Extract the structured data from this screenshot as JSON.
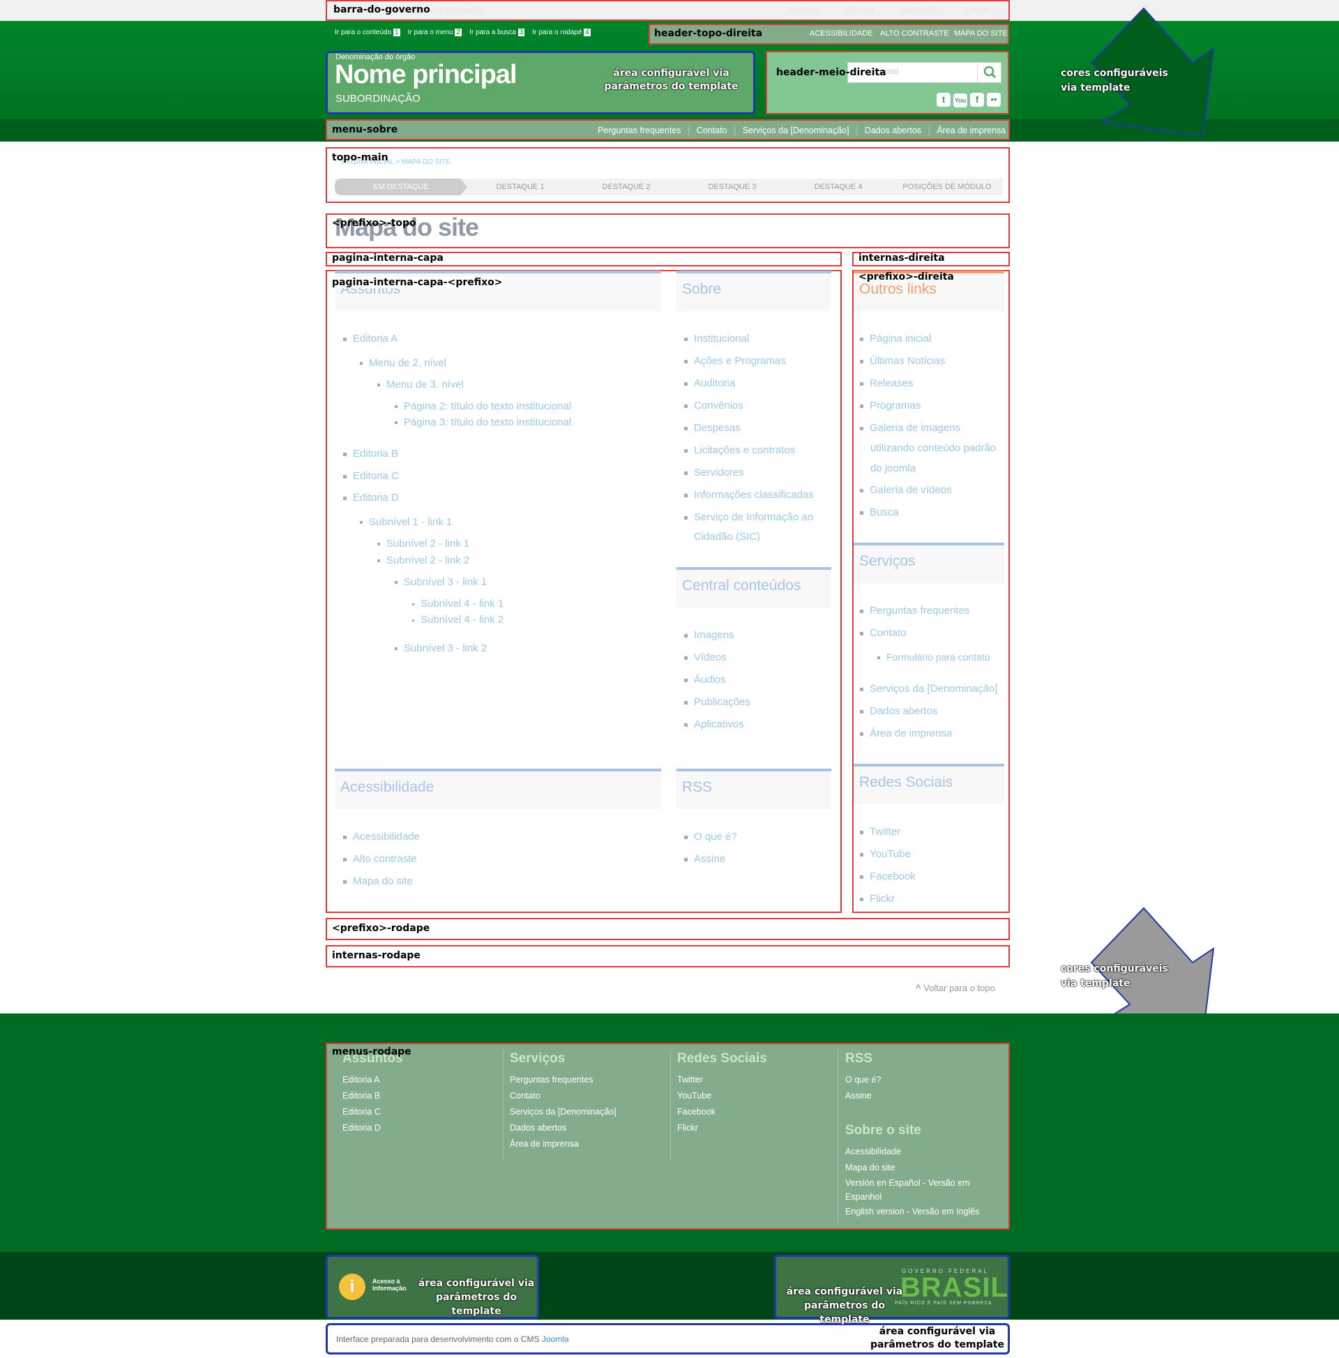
{
  "gov_bar": {
    "label": "barra-do-governo",
    "links": [
      "Acesso à informação",
      "Participe",
      "Serviços",
      "Legislação",
      "Canais"
    ]
  },
  "header": {
    "skip_links": [
      "Ir para o conteúdo",
      "Ir para o menu",
      "Ir para a busca",
      "Ir para o rodapé"
    ],
    "skip_keys": [
      "1",
      "2",
      "3",
      "4"
    ],
    "top_right_label": "header-topo-direita",
    "top_right_links": [
      "ACESSIBILIDADE",
      "ALTO CONTRASTE",
      "MAPA DO SITE"
    ],
    "org_denomination": "Denominação do órgão",
    "main_name": "Nome principal",
    "subordination": "SUBORDINAÇÃO",
    "config_note": "área configurável via parâmetros do template",
    "mid_right_label": "header-meio-direita",
    "search_placeholder": "o portal",
    "social_icons": [
      "twitter-icon",
      "youtube-icon",
      "facebook-icon",
      "flickr-icon"
    ],
    "colors_note": "cores configuráveis via template"
  },
  "menu_sobre": {
    "label": "menu-sobre",
    "links": [
      "Perguntas frequentes",
      "Contato",
      "Serviços da [Denominação]",
      "Dados abertos",
      "Área de imprensa"
    ]
  },
  "topo_main": {
    "label": "topo-main",
    "breadcrumb": "PÁGINA INICIAL > MAPA DO SITE",
    "tabs": [
      "EM DESTAQUE",
      "DESTAQUE 1",
      "DESTAQUE 2",
      "DESTAQUE 3",
      "DESTAQUE 4",
      "POSIÇÕES DE MÓDULO"
    ]
  },
  "prefixo_topo": {
    "label": "<prefixo>-topo",
    "page_title": "Mapa do site"
  },
  "pagina_interna_capa": {
    "label": "pagina-interna-capa",
    "inner_label": "pagina-interna-capa-<prefixo>"
  },
  "internas_direita": {
    "label": "internas-direita",
    "inner_label": "<prefixo>-direita"
  },
  "assuntos": {
    "title": "Assuntos",
    "items": [
      "Editoria A",
      "Menu de 2. nível",
      "Menu de 3. nível",
      "Página 2: título do texto institucional",
      "Página 3: título do texto institucional",
      "Editoria B",
      "Editoria C",
      "Editoria D",
      "Subnível 1 - link 1",
      "Subnível 2 - link 1",
      "Subnível 2 - link 2",
      "Subnível 3 - link 1",
      "Subnível 4 - link 1",
      "Subnível 4 - link 2",
      "Subnível 3 - link 2"
    ]
  },
  "sobre": {
    "title": "Sobre",
    "items": [
      "Institucional",
      "Ações e Programas",
      "Auditoria",
      "Convênios",
      "Despesas",
      "Licitações e contratos",
      "Servidores",
      "Informações classificadas",
      "Serviço de Informação ao",
      "Cidadão (SIC)"
    ]
  },
  "central": {
    "title": "Central conteúdos",
    "items": [
      "Imagens",
      "Vídeos",
      "Áudios",
      "Publicações",
      "Aplicativos"
    ]
  },
  "acessibilidade": {
    "title": "Acessibilidade",
    "items": [
      "Acessibilidade",
      "Alto contraste",
      "Mapa do site"
    ]
  },
  "rss": {
    "title": "RSS",
    "items": [
      "O que é?",
      "Assine"
    ]
  },
  "outros_links": {
    "title": "Outros links",
    "items": [
      "Página inicial",
      "Últimas Notícias",
      "Releases",
      "Programas",
      "Galeria de imagens",
      "utilizando conteúdo padrão",
      "do joomla",
      "Galeria de vídeos",
      "Busca"
    ]
  },
  "servicos": {
    "title": "Serviços",
    "items": [
      "Perguntas frequentes",
      "Contato",
      "Formulário para contato",
      "Serviços da [Denominação]",
      "Dados abertos",
      "Área de imprensa"
    ]
  },
  "redes": {
    "title": "Redes Sociais",
    "items": [
      "Twitter",
      "YouTube",
      "Facebook",
      "Flickr"
    ]
  },
  "prefixo_rodape": {
    "label": "<prefixo>-rodape"
  },
  "internas_rodape": {
    "label": "internas-rodape"
  },
  "back_to_top": "Voltar para o topo",
  "footer": {
    "label": "menus-rodape",
    "columns": [
      {
        "title": "Assuntos",
        "items": [
          "Editoria A",
          "Editoria B",
          "Editoria C",
          "Editoria D"
        ]
      },
      {
        "title": "Serviços",
        "items": [
          "Perguntas frequentes",
          "Contato",
          "Serviços da [Denominação]",
          "Dados abertos",
          "Área de imprensa"
        ]
      },
      {
        "title": "Redes Sociais",
        "items": [
          "Twitter",
          "YouTube",
          "Facebook",
          "Flickr"
        ]
      },
      {
        "title": "RSS",
        "items": [
          "O que é?",
          "Assine"
        ]
      },
      {
        "title": "Sobre o site",
        "items": [
          "Acessibilidade",
          "Mapa do site",
          "Versión en Español - Versão em",
          "Espanhol",
          "English version - Versão em Inglês"
        ]
      }
    ],
    "acesso_info": "Acesso à Informação",
    "brasil_top": "GOVERNO FEDERAL",
    "brasil_main": "BRASIL",
    "brasil_bottom": "PAÍS RICO É PAÍS SEM POBREZA",
    "credits_text": "Interface preparada para desenvolvimento com o CMS",
    "credits_link": "Joomla"
  },
  "colors": {
    "green": "#00852a",
    "dark_green": "#004d17",
    "panel": "#83ad8a",
    "red_box": "#e23a3a",
    "blue_box": "#1f3aa8",
    "link": "#9dc8ea"
  }
}
